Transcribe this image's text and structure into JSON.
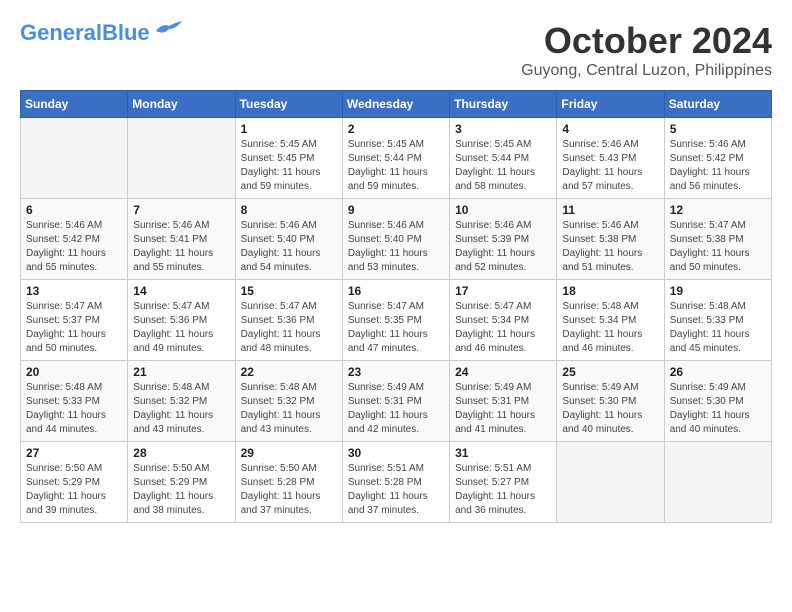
{
  "header": {
    "logo_general": "General",
    "logo_blue": "Blue",
    "month_title": "October 2024",
    "location": "Guyong, Central Luzon, Philippines"
  },
  "weekdays": [
    "Sunday",
    "Monday",
    "Tuesday",
    "Wednesday",
    "Thursday",
    "Friday",
    "Saturday"
  ],
  "weeks": [
    [
      {
        "day": "",
        "sunrise": "",
        "sunset": "",
        "daylight": ""
      },
      {
        "day": "",
        "sunrise": "",
        "sunset": "",
        "daylight": ""
      },
      {
        "day": "1",
        "sunrise": "Sunrise: 5:45 AM",
        "sunset": "Sunset: 5:45 PM",
        "daylight": "Daylight: 11 hours and 59 minutes."
      },
      {
        "day": "2",
        "sunrise": "Sunrise: 5:45 AM",
        "sunset": "Sunset: 5:44 PM",
        "daylight": "Daylight: 11 hours and 59 minutes."
      },
      {
        "day": "3",
        "sunrise": "Sunrise: 5:45 AM",
        "sunset": "Sunset: 5:44 PM",
        "daylight": "Daylight: 11 hours and 58 minutes."
      },
      {
        "day": "4",
        "sunrise": "Sunrise: 5:46 AM",
        "sunset": "Sunset: 5:43 PM",
        "daylight": "Daylight: 11 hours and 57 minutes."
      },
      {
        "day": "5",
        "sunrise": "Sunrise: 5:46 AM",
        "sunset": "Sunset: 5:42 PM",
        "daylight": "Daylight: 11 hours and 56 minutes."
      }
    ],
    [
      {
        "day": "6",
        "sunrise": "Sunrise: 5:46 AM",
        "sunset": "Sunset: 5:42 PM",
        "daylight": "Daylight: 11 hours and 55 minutes."
      },
      {
        "day": "7",
        "sunrise": "Sunrise: 5:46 AM",
        "sunset": "Sunset: 5:41 PM",
        "daylight": "Daylight: 11 hours and 55 minutes."
      },
      {
        "day": "8",
        "sunrise": "Sunrise: 5:46 AM",
        "sunset": "Sunset: 5:40 PM",
        "daylight": "Daylight: 11 hours and 54 minutes."
      },
      {
        "day": "9",
        "sunrise": "Sunrise: 5:46 AM",
        "sunset": "Sunset: 5:40 PM",
        "daylight": "Daylight: 11 hours and 53 minutes."
      },
      {
        "day": "10",
        "sunrise": "Sunrise: 5:46 AM",
        "sunset": "Sunset: 5:39 PM",
        "daylight": "Daylight: 11 hours and 52 minutes."
      },
      {
        "day": "11",
        "sunrise": "Sunrise: 5:46 AM",
        "sunset": "Sunset: 5:38 PM",
        "daylight": "Daylight: 11 hours and 51 minutes."
      },
      {
        "day": "12",
        "sunrise": "Sunrise: 5:47 AM",
        "sunset": "Sunset: 5:38 PM",
        "daylight": "Daylight: 11 hours and 50 minutes."
      }
    ],
    [
      {
        "day": "13",
        "sunrise": "Sunrise: 5:47 AM",
        "sunset": "Sunset: 5:37 PM",
        "daylight": "Daylight: 11 hours and 50 minutes."
      },
      {
        "day": "14",
        "sunrise": "Sunrise: 5:47 AM",
        "sunset": "Sunset: 5:36 PM",
        "daylight": "Daylight: 11 hours and 49 minutes."
      },
      {
        "day": "15",
        "sunrise": "Sunrise: 5:47 AM",
        "sunset": "Sunset: 5:36 PM",
        "daylight": "Daylight: 11 hours and 48 minutes."
      },
      {
        "day": "16",
        "sunrise": "Sunrise: 5:47 AM",
        "sunset": "Sunset: 5:35 PM",
        "daylight": "Daylight: 11 hours and 47 minutes."
      },
      {
        "day": "17",
        "sunrise": "Sunrise: 5:47 AM",
        "sunset": "Sunset: 5:34 PM",
        "daylight": "Daylight: 11 hours and 46 minutes."
      },
      {
        "day": "18",
        "sunrise": "Sunrise: 5:48 AM",
        "sunset": "Sunset: 5:34 PM",
        "daylight": "Daylight: 11 hours and 46 minutes."
      },
      {
        "day": "19",
        "sunrise": "Sunrise: 5:48 AM",
        "sunset": "Sunset: 5:33 PM",
        "daylight": "Daylight: 11 hours and 45 minutes."
      }
    ],
    [
      {
        "day": "20",
        "sunrise": "Sunrise: 5:48 AM",
        "sunset": "Sunset: 5:33 PM",
        "daylight": "Daylight: 11 hours and 44 minutes."
      },
      {
        "day": "21",
        "sunrise": "Sunrise: 5:48 AM",
        "sunset": "Sunset: 5:32 PM",
        "daylight": "Daylight: 11 hours and 43 minutes."
      },
      {
        "day": "22",
        "sunrise": "Sunrise: 5:48 AM",
        "sunset": "Sunset: 5:32 PM",
        "daylight": "Daylight: 11 hours and 43 minutes."
      },
      {
        "day": "23",
        "sunrise": "Sunrise: 5:49 AM",
        "sunset": "Sunset: 5:31 PM",
        "daylight": "Daylight: 11 hours and 42 minutes."
      },
      {
        "day": "24",
        "sunrise": "Sunrise: 5:49 AM",
        "sunset": "Sunset: 5:31 PM",
        "daylight": "Daylight: 11 hours and 41 minutes."
      },
      {
        "day": "25",
        "sunrise": "Sunrise: 5:49 AM",
        "sunset": "Sunset: 5:30 PM",
        "daylight": "Daylight: 11 hours and 40 minutes."
      },
      {
        "day": "26",
        "sunrise": "Sunrise: 5:49 AM",
        "sunset": "Sunset: 5:30 PM",
        "daylight": "Daylight: 11 hours and 40 minutes."
      }
    ],
    [
      {
        "day": "27",
        "sunrise": "Sunrise: 5:50 AM",
        "sunset": "Sunset: 5:29 PM",
        "daylight": "Daylight: 11 hours and 39 minutes."
      },
      {
        "day": "28",
        "sunrise": "Sunrise: 5:50 AM",
        "sunset": "Sunset: 5:29 PM",
        "daylight": "Daylight: 11 hours and 38 minutes."
      },
      {
        "day": "29",
        "sunrise": "Sunrise: 5:50 AM",
        "sunset": "Sunset: 5:28 PM",
        "daylight": "Daylight: 11 hours and 37 minutes."
      },
      {
        "day": "30",
        "sunrise": "Sunrise: 5:51 AM",
        "sunset": "Sunset: 5:28 PM",
        "daylight": "Daylight: 11 hours and 37 minutes."
      },
      {
        "day": "31",
        "sunrise": "Sunrise: 5:51 AM",
        "sunset": "Sunset: 5:27 PM",
        "daylight": "Daylight: 11 hours and 36 minutes."
      },
      {
        "day": "",
        "sunrise": "",
        "sunset": "",
        "daylight": ""
      },
      {
        "day": "",
        "sunrise": "",
        "sunset": "",
        "daylight": ""
      }
    ]
  ]
}
